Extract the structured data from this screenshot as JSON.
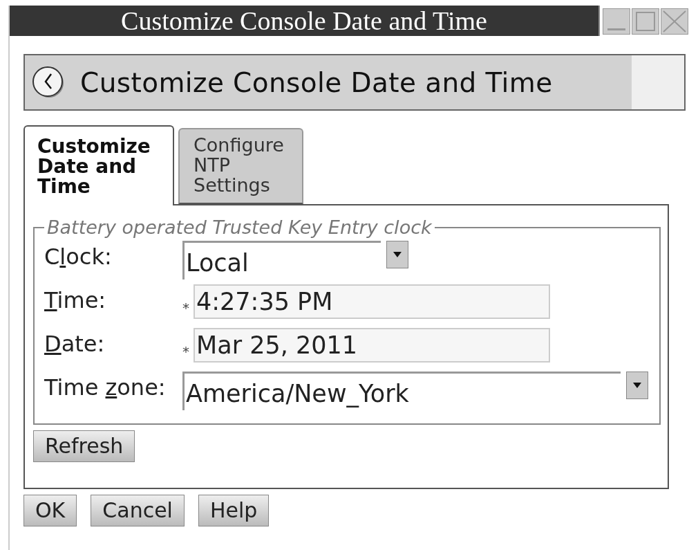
{
  "window": {
    "title": "Customize Console Date and Time"
  },
  "header": {
    "title": "Customize Console Date and Time"
  },
  "tabs": [
    {
      "label": "Customize\nDate and\nTime",
      "selected": true
    },
    {
      "label": "Configure\nNTP\nSettings",
      "selected": false
    }
  ],
  "group": {
    "title": "Battery operated Trusted Key Entry clock"
  },
  "fields": [
    {
      "kind": "dropdown",
      "label": {
        "before": "C",
        "mnemonic": "l",
        "after": "ock:"
      },
      "value": "Local"
    },
    {
      "kind": "text",
      "label": {
        "mnemonic": "T",
        "after": "ime:"
      },
      "marker": "*",
      "value": "4:27:35 PM"
    },
    {
      "kind": "text",
      "label": {
        "mnemonic": "D",
        "after": "ate:"
      },
      "marker": "*",
      "value": "Mar 25, 2011"
    },
    {
      "kind": "wide-dropdown",
      "label": {
        "before": "Time ",
        "mnemonic": "z",
        "after": "one:"
      },
      "value": "America/New_York"
    }
  ],
  "refresh_button": "Refresh",
  "buttons": [
    "OK",
    "Cancel",
    "Help"
  ]
}
